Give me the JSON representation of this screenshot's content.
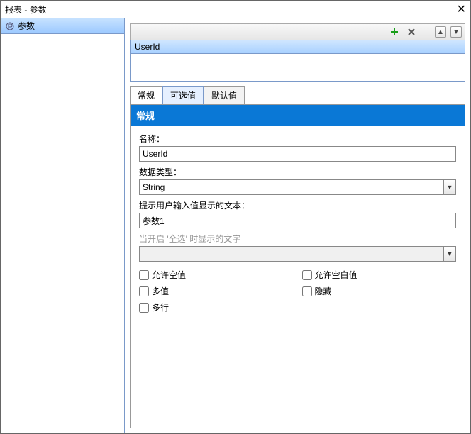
{
  "window": {
    "title": "报表 - 参数"
  },
  "left": {
    "rootLabel": "参数"
  },
  "toolbar": {
    "addTip": "+",
    "delTip": "×",
    "upTip": "▲",
    "downTip": "▼"
  },
  "paramList": {
    "items": [
      "UserId"
    ]
  },
  "tabs": {
    "general": "常规",
    "available": "可选值",
    "default": "默认值"
  },
  "section": {
    "generalHeader": "常规"
  },
  "form": {
    "nameLabel": "名称：",
    "nameValue": "UserId",
    "dataTypeLabel": "数据类型：",
    "dataTypeValue": "String",
    "promptLabel": "提示用户输入值显示的文本：",
    "promptValue": "参数1",
    "selectAllLabel": "当开启 '全选' 时显示的文字",
    "selectAllValue": ""
  },
  "checks": {
    "allowNull": "允许空值",
    "allowBlank": "允许空白值",
    "multiValue": "多值",
    "hidden": "隐藏",
    "multiLine": "多行"
  }
}
